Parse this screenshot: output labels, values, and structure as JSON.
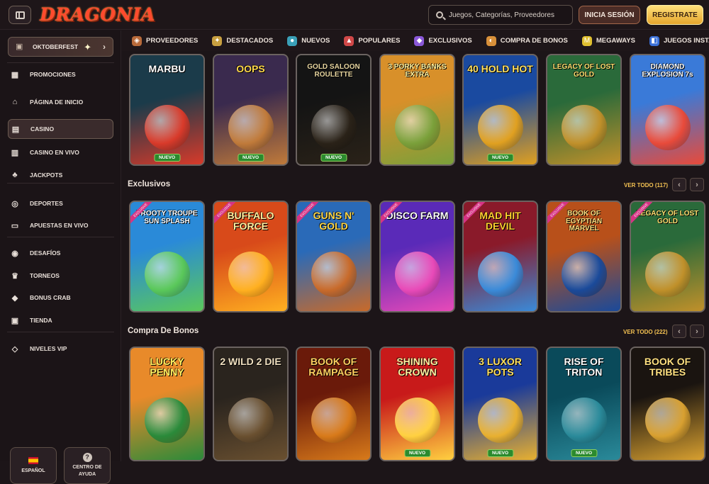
{
  "header": {
    "logo": "DRAGONIA",
    "search_placeholder": "Juegos, Categorías, Proveedores",
    "login": "INICIA SESIÓN",
    "register": "REGISTRATE"
  },
  "sidebar": {
    "promo": "OKTOBERFEST",
    "items": [
      {
        "label": "PROMOCIONES",
        "icon": "gift-icon"
      },
      {
        "label": "PÁGINA DE INICIO",
        "icon": "home-icon"
      },
      {
        "label": "CASINO",
        "icon": "cards-icon"
      },
      {
        "label": "CASINO EN VIVO",
        "icon": "live-cards-icon"
      },
      {
        "label": "JACKPOTS",
        "icon": "clover-icon"
      },
      {
        "label": "DEPORTES",
        "icon": "ball-icon"
      },
      {
        "label": "APUESTAS EN VIVO",
        "icon": "live-icon"
      },
      {
        "label": "DESAFÍOS",
        "icon": "challenge-icon"
      },
      {
        "label": "TORNEOS",
        "icon": "trophy-icon"
      },
      {
        "label": "BONUS CRAB",
        "icon": "crab-icon"
      },
      {
        "label": "TIENDA",
        "icon": "shop-icon"
      },
      {
        "label": "NIVELES VIP",
        "icon": "diamond-icon"
      }
    ],
    "language": "ESPAÑOL",
    "help_line1": "CENTRO DE",
    "help_line2": "AYUDA"
  },
  "categories": [
    {
      "label": "PROVEEDORES",
      "icon": "providers-icon",
      "color": "#b86a3a"
    },
    {
      "label": "DESTACADOS",
      "icon": "star-icon",
      "color": "#c8a040"
    },
    {
      "label": "NUEVOS",
      "icon": "new-icon",
      "color": "#3aa0b8"
    },
    {
      "label": "POPULARES",
      "icon": "rocket-icon",
      "color": "#d04848"
    },
    {
      "label": "EXCLUSIVOS",
      "icon": "gem-icon",
      "color": "#8a58d8"
    },
    {
      "label": "COMPRA DE BONOS",
      "icon": "bonus-icon",
      "color": "#d8903a"
    },
    {
      "label": "MEGAWAYS",
      "icon": "megaways-icon",
      "color": "#e0c030"
    },
    {
      "label": "JUEGOS INSTANTÁNEOS",
      "icon": "instant-icon",
      "color": "#3a70d8"
    }
  ],
  "sections": {
    "new_games": {
      "badge": "NUEVO",
      "games": [
        {
          "title": "MARBU",
          "bg1": "#1b3b4a",
          "bg2": "#d83a2a",
          "fg": "#ffffff",
          "badge": true
        },
        {
          "title": "OOPS",
          "bg1": "#3a2a4e",
          "bg2": "#c07a3a",
          "fg": "#ffd84a",
          "badge": true
        },
        {
          "title": "GOLD SALOON ROULETTE",
          "bg1": "#141414",
          "bg2": "#2a2218",
          "fg": "#e8d6a0",
          "badge": true
        },
        {
          "title": "3 PORKY BANKS EXTRA",
          "bg1": "#d8902a",
          "bg2": "#7aa03a",
          "fg": "#fff3a0",
          "badge": false
        },
        {
          "title": "40 HOLD HOT",
          "bg1": "#1a4aa0",
          "bg2": "#e0a020",
          "fg": "#ffe060",
          "badge": true
        },
        {
          "title": "LEGACY OF LOST GOLD",
          "bg1": "#2a6a3a",
          "bg2": "#c0902a",
          "fg": "#ffe070",
          "badge": false
        },
        {
          "title": "DIAMOND EXPLOSION 7s",
          "bg1": "#3a7ad8",
          "bg2": "#e84a3a",
          "fg": "#ffffff",
          "badge": false
        }
      ]
    },
    "exclusive": {
      "title": "Exclusivos",
      "see_all": "VER TODO (117)",
      "ribbon": "EXCLUSIVE",
      "games": [
        {
          "title": "FROOTY TROUPE SUN SPLASH",
          "bg1": "#2a8ad8",
          "bg2": "#5ac85a",
          "fg": "#ffffff"
        },
        {
          "title": "BUFFALO FORCE",
          "bg1": "#d84a1a",
          "bg2": "#ffb020",
          "fg": "#fff0a0"
        },
        {
          "title": "GUNS N' GOLD",
          "bg1": "#2a6ab8",
          "bg2": "#c86a2a",
          "fg": "#ffd84a"
        },
        {
          "title": "DISCO FARM",
          "bg1": "#5a2ab8",
          "bg2": "#e84ab8",
          "fg": "#ffffff"
        },
        {
          "title": "MAD HIT DEVIL",
          "bg1": "#8a1a2a",
          "bg2": "#3a8ad8",
          "fg": "#ffd030"
        },
        {
          "title": "BOOK OF EGYPTIAN MARVEL",
          "bg1": "#b8501a",
          "bg2": "#1a4a9a",
          "fg": "#ffe080"
        },
        {
          "title": "LEGACY OF LOST GOLD",
          "bg1": "#2a6a3a",
          "bg2": "#c0902a",
          "fg": "#ffe070"
        }
      ]
    },
    "bonus_buy": {
      "title": "Compra De Bonos",
      "see_all": "VER TODO (222)",
      "games": [
        {
          "title": "LUCKY PENNY",
          "bg1": "#e88a2a",
          "bg2": "#2a8a3a",
          "fg": "#fff060",
          "badge": false
        },
        {
          "title": "2 WILD 2 DIE",
          "bg1": "#2a241e",
          "bg2": "#6a5030",
          "fg": "#f0e0c0",
          "badge": false
        },
        {
          "title": "BOOK OF RAMPAGE",
          "bg1": "#6a1a0a",
          "bg2": "#d87a1a",
          "fg": "#ffd060",
          "badge": false
        },
        {
          "title": "SHINING CROWN",
          "bg1": "#c81a1a",
          "bg2": "#ffd040",
          "fg": "#fff0a0",
          "badge": true
        },
        {
          "title": "3 LUXOR POTS",
          "bg1": "#1a3a9a",
          "bg2": "#e8b030",
          "fg": "#ffe060",
          "badge": true
        },
        {
          "title": "RISE OF TRITON",
          "bg1": "#0a4a5a",
          "bg2": "#2a8a9a",
          "fg": "#ffffff",
          "badge": true
        },
        {
          "title": "BOOK OF TRIBES",
          "bg1": "#1a1410",
          "bg2": "#d8a030",
          "fg": "#ffe080",
          "badge": false
        }
      ]
    }
  }
}
